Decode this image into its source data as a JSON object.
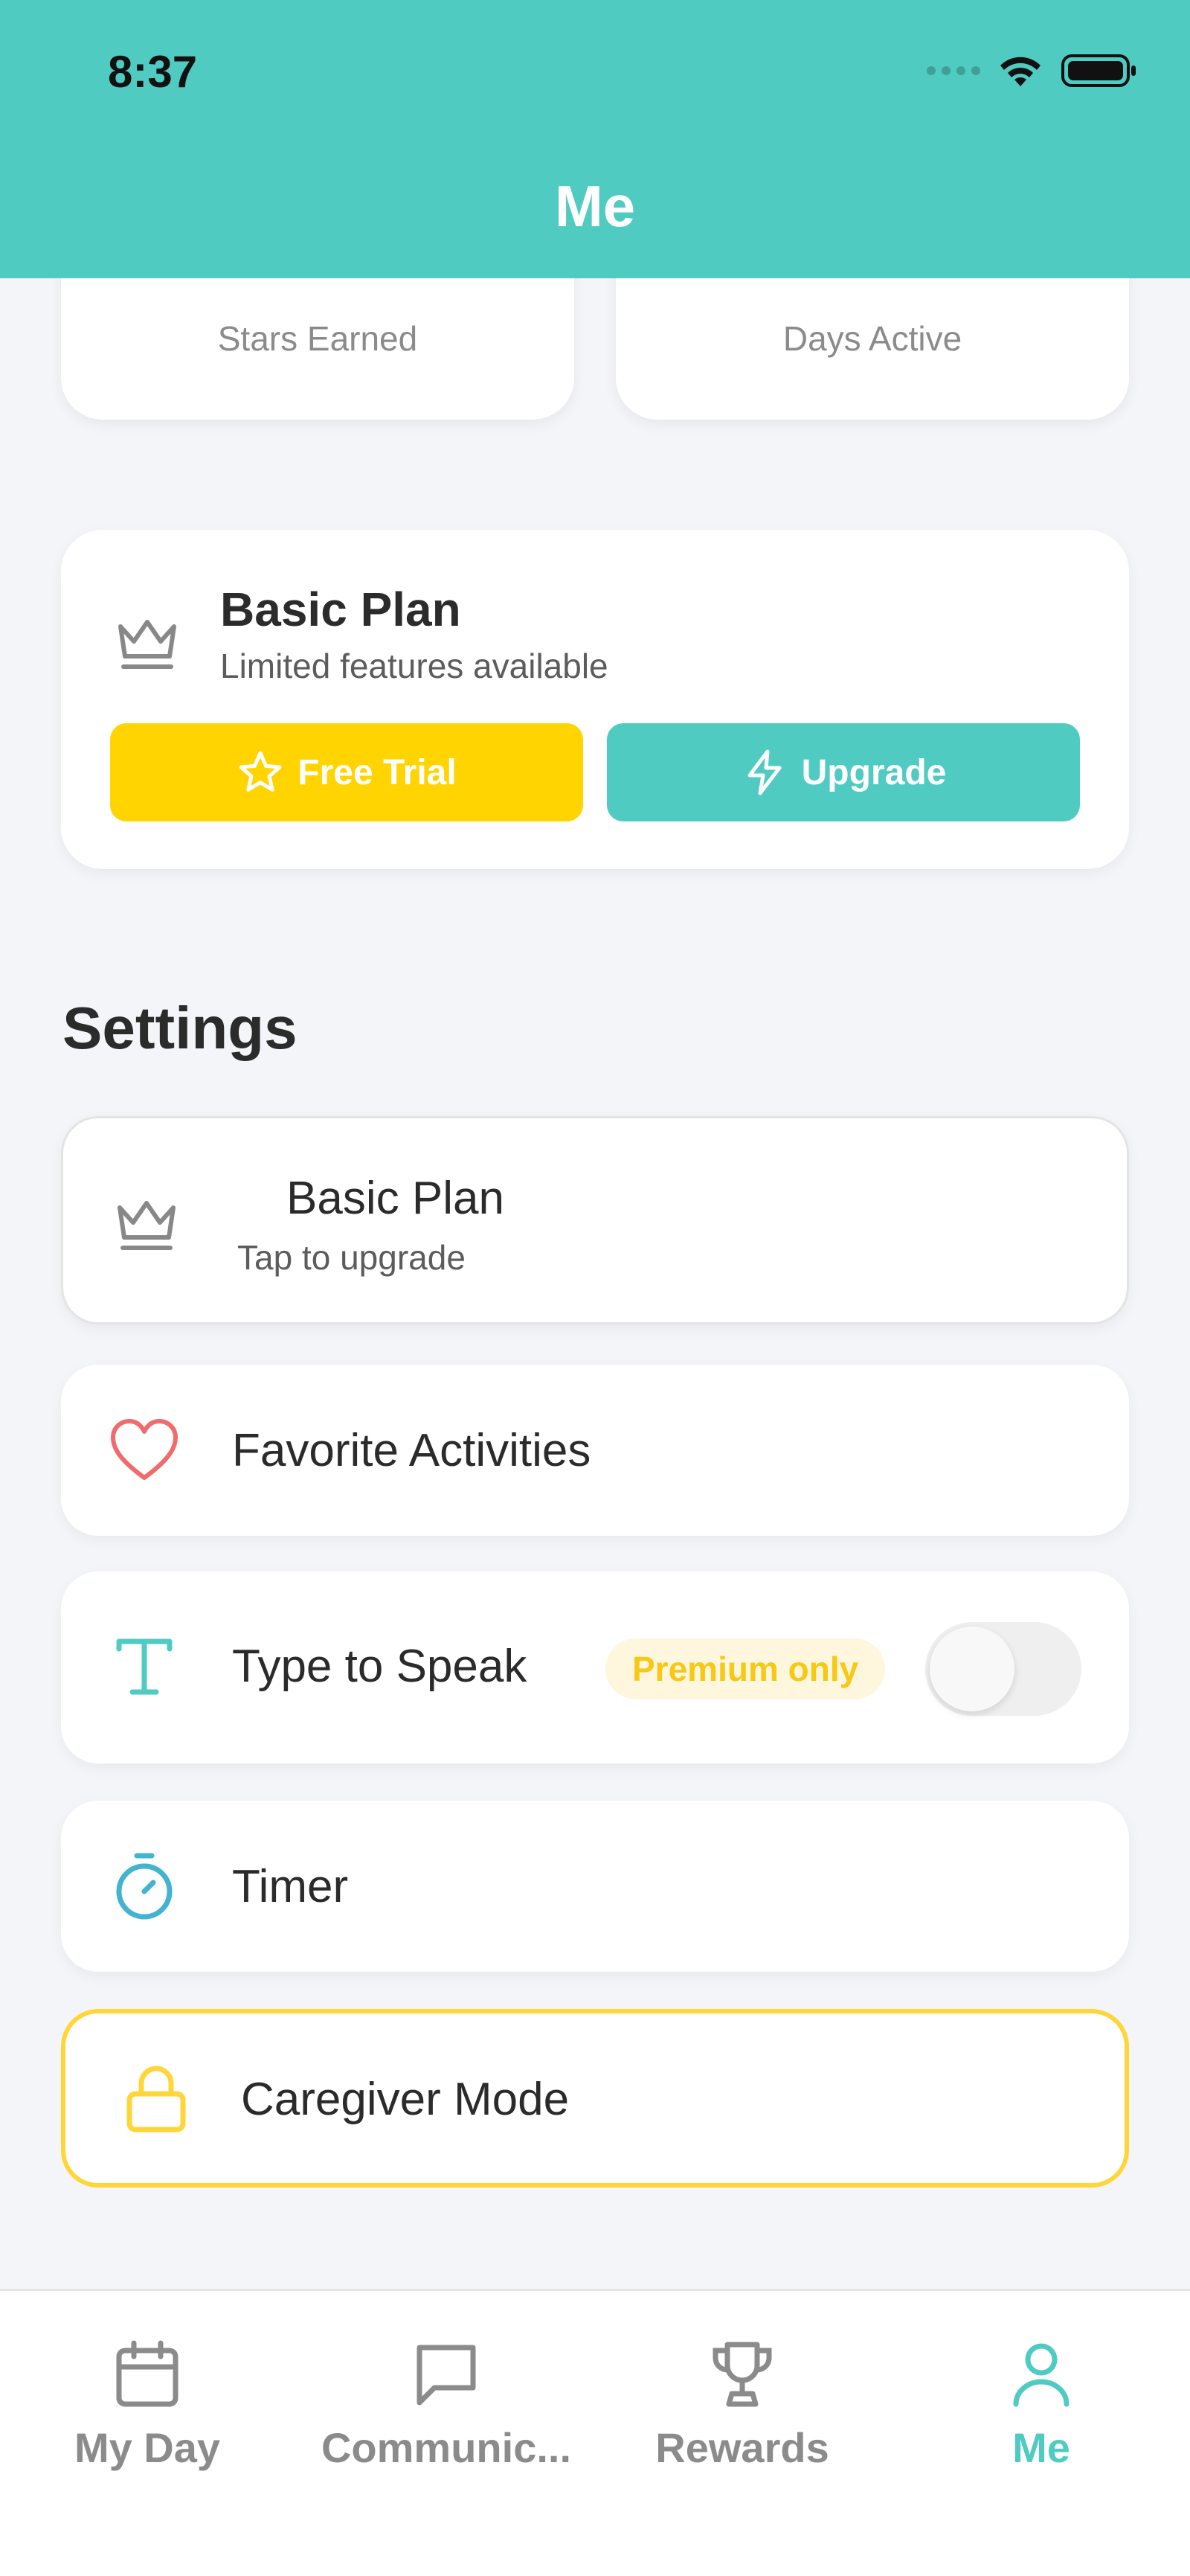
{
  "status_bar": {
    "time": "8:37"
  },
  "header": {
    "title": "Me"
  },
  "stats": [
    {
      "label": "Stars Earned"
    },
    {
      "label": "Days Active"
    }
  ],
  "plan_card": {
    "title": "Basic Plan",
    "subtitle": "Limited features available",
    "free_trial_label": "Free Trial",
    "upgrade_label": "Upgrade"
  },
  "settings": {
    "title": "Settings",
    "plan_row": {
      "label": "Basic Plan",
      "sub": "Tap to upgrade"
    },
    "favorites_row": {
      "label": "Favorite Activities"
    },
    "type_to_speak_row": {
      "label": "Type to Speak",
      "badge": "Premium only",
      "enabled": false
    },
    "timer_row": {
      "label": "Timer"
    },
    "caregiver_row": {
      "label": "Caregiver Mode"
    }
  },
  "tabbar": {
    "tabs": [
      {
        "label": "My Day",
        "icon": "calendar-icon"
      },
      {
        "label": "Communic...",
        "icon": "chat-bubble-icon"
      },
      {
        "label": "Rewards",
        "icon": "trophy-icon"
      },
      {
        "label": "Me",
        "icon": "person-icon",
        "active": true
      }
    ]
  },
  "colors": {
    "accent": "#50cbc2",
    "yellow": "#ffd400",
    "heart": "#f06b6b",
    "background": "#f4f5f9"
  }
}
